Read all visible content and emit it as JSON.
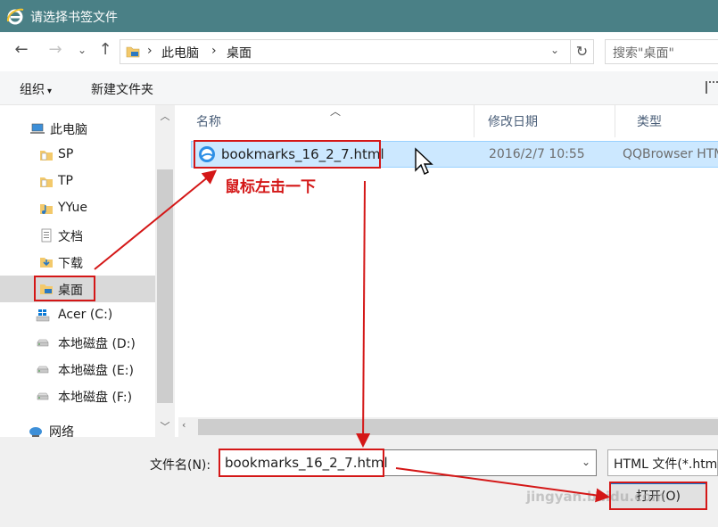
{
  "window": {
    "title": "请选择书签文件"
  },
  "addressbar": {
    "crumbs": [
      "此电脑",
      "桌面"
    ],
    "search_placeholder": "搜索\"桌面\""
  },
  "commandbar": {
    "organize": "组织",
    "new_folder": "新建文件夹"
  },
  "nav": {
    "items": [
      {
        "label": "此电脑",
        "icon": "computer-icon"
      },
      {
        "label": "SP",
        "icon": "folder-icon"
      },
      {
        "label": "TP",
        "icon": "folder-icon"
      },
      {
        "label": "YYue",
        "icon": "music-folder-icon"
      },
      {
        "label": "文档",
        "icon": "documents-icon"
      },
      {
        "label": "下载",
        "icon": "downloads-icon"
      },
      {
        "label": "桌面",
        "icon": "desktop-folder-icon",
        "selected": true
      },
      {
        "label": "Acer (C:)",
        "icon": "windows-drive-icon"
      },
      {
        "label": "本地磁盘 (D:)",
        "icon": "drive-icon"
      },
      {
        "label": "本地磁盘 (E:)",
        "icon": "drive-icon"
      },
      {
        "label": "本地磁盘 (F:)",
        "icon": "drive-icon"
      },
      {
        "label": "网络",
        "icon": "network-icon"
      }
    ]
  },
  "columns": [
    "名称",
    "修改日期",
    "类型"
  ],
  "files": [
    {
      "name": "bookmarks_16_2_7.html",
      "modified": "2016/2/7 10:55",
      "type": "QQBrowser HTML",
      "icon": "qqbrowser-icon"
    }
  ],
  "bottom": {
    "filename_label": "文件名(N):",
    "filename_value": "bookmarks_16_2_7.html",
    "filetype_value": "HTML 文件(*.htm",
    "open_label": "打开(O)"
  },
  "annotation": {
    "text": "鼠标左击一下",
    "color": "#d41717"
  },
  "watermark": "jingyan.baidu.com",
  "colors": {
    "titlebar": "#4a8086",
    "selection": "#cce8ff",
    "annotation": "#d41717"
  }
}
